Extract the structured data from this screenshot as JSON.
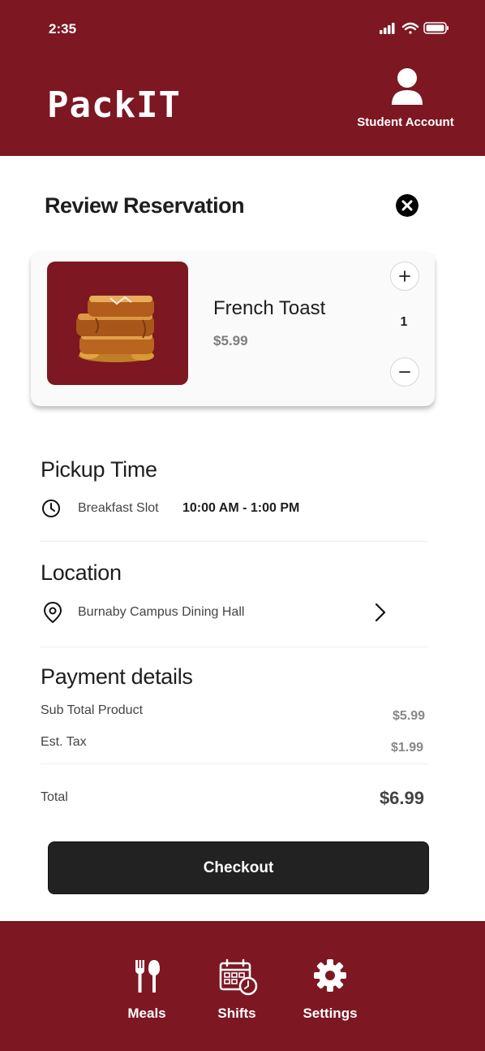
{
  "status_bar": {
    "time": "2:35"
  },
  "header": {
    "brand": "PackIT",
    "account_label": "Student Account"
  },
  "review": {
    "title": "Review Reservation",
    "item": {
      "name": "French Toast",
      "price": "$5.99",
      "quantity": "1"
    }
  },
  "pickup": {
    "title": "Pickup Time",
    "slot_label": "Breakfast Slot",
    "slot_time": "10:00 AM - 1:00 PM"
  },
  "location": {
    "title": "Location",
    "name": "Burnaby Campus Dining Hall"
  },
  "payment": {
    "title": "Payment details",
    "subtotal_label": "Sub Total Product",
    "subtotal_value": "$5.99",
    "tax_label": "Est. Tax",
    "tax_value": "$1.99",
    "total_label": "Total",
    "total_value": "$6.99"
  },
  "checkout_label": "Checkout",
  "nav": {
    "items": [
      {
        "label": "Meals",
        "icon": "fork-spoon-icon"
      },
      {
        "label": "Shifts",
        "icon": "calendar-clock-icon"
      },
      {
        "label": "Settings",
        "icon": "gear-icon"
      }
    ]
  },
  "colors": {
    "brand": "#7d1722",
    "button": "#222222"
  }
}
